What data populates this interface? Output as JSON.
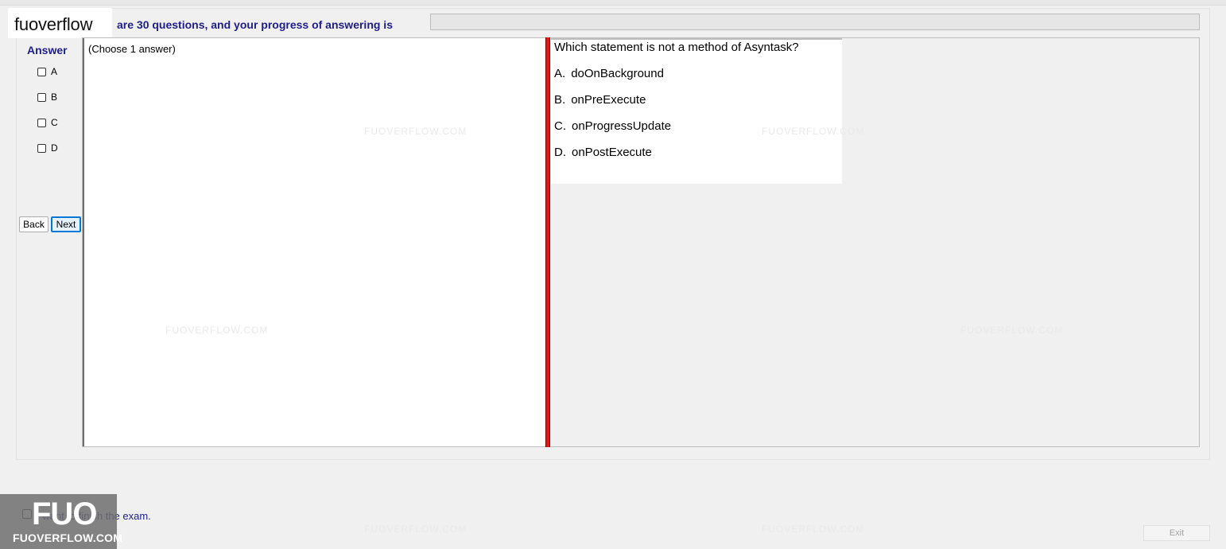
{
  "header": {
    "progress_text": "are 30 questions, and your progress of answering is",
    "progress_fraction": 0
  },
  "logo": {
    "text": "fuoverflow"
  },
  "answer_panel": {
    "title": "Answer",
    "options": [
      {
        "label": "A",
        "checked": false
      },
      {
        "label": "B",
        "checked": false
      },
      {
        "label": "C",
        "checked": false
      },
      {
        "label": "D",
        "checked": false
      }
    ],
    "back_label": "Back",
    "next_label": "Next"
  },
  "left_pane": {
    "instruction": "(Choose 1 answer)"
  },
  "question": {
    "text": "Which statement is not a method of Asyntask?",
    "options": [
      {
        "letter": "A.",
        "text": "doOnBackground"
      },
      {
        "letter": "B.",
        "text": "onPreExecute"
      },
      {
        "letter": "C.",
        "text": "onProgressUpdate"
      },
      {
        "letter": "D.",
        "text": "onPostExecute"
      }
    ]
  },
  "footer": {
    "finish_label": "I want to finish the exam.",
    "exit_label": "Exit"
  },
  "watermark": {
    "big": "FUO",
    "site": "FUOVERFLOW.COM",
    "faint": "FUOVERFLOW.COM"
  },
  "colors": {
    "accent_text": "#1e1e8c",
    "splitter": "#e0191d",
    "progress_fill": "#06b025"
  }
}
